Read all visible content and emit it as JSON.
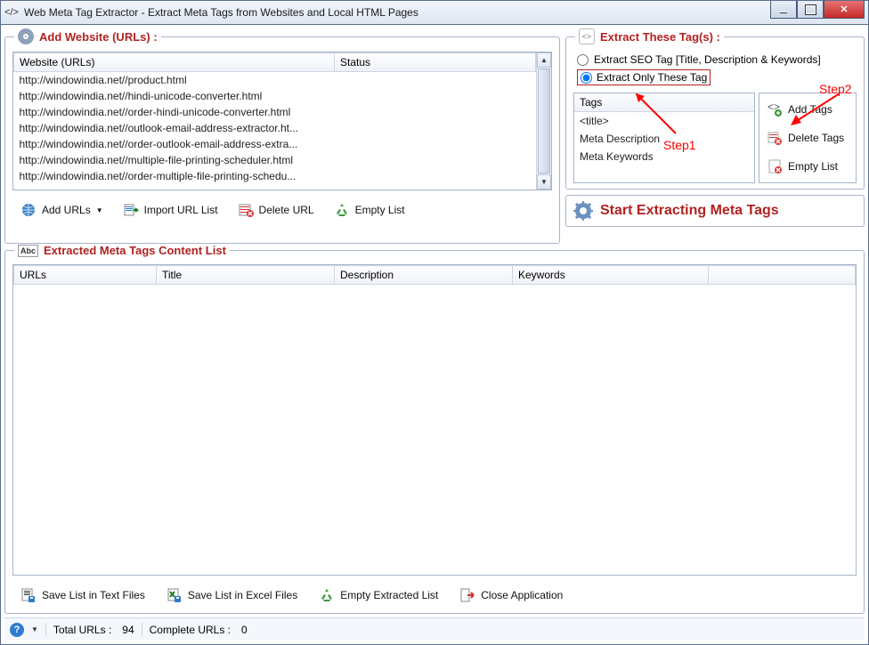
{
  "window": {
    "title": "Web Meta Tag Extractor - Extract Meta Tags from Websites and Local HTML Pages"
  },
  "panels": {
    "add_urls": {
      "heading": "Add Website (URLs) :",
      "columns": {
        "website": "Website (URLs)",
        "status": "Status"
      },
      "rows": [
        "http://windowindia.net//product.html",
        "http://windowindia.net//hindi-unicode-converter.html",
        "http://windowindia.net//order-hindi-unicode-converter.html",
        "http://windowindia.net//outlook-email-address-extractor.ht...",
        "http://windowindia.net//order-outlook-email-address-extra...",
        "http://windowindia.net//multiple-file-printing-scheduler.html",
        "http://windowindia.net//order-multiple-file-printing-schedu..."
      ],
      "buttons": {
        "add": "Add URLs",
        "import": "Import URL List",
        "delete": "Delete URL",
        "empty": "Empty List"
      }
    },
    "extract_tags": {
      "heading": "Extract These Tag(s) :",
      "radio_seo": "Extract SEO Tag [Title, Description & Keywords]",
      "radio_only": "Extract Only These Tag",
      "tags_header": "Tags",
      "tags": [
        "<title>",
        "Meta Description",
        "Meta Keywords"
      ],
      "buttons": {
        "add": "Add Tags",
        "delete": "Delete Tags",
        "empty": "Empty List"
      }
    },
    "start": "Start Extracting Meta Tags",
    "extracted": {
      "heading": "Extracted Meta Tags Content List",
      "columns": {
        "urls": "URLs",
        "title": "Title",
        "description": "Description",
        "keywords": "Keywords"
      }
    }
  },
  "bottom": {
    "save_text": "Save List in Text Files",
    "save_excel": "Save List in Excel Files",
    "empty": "Empty Extracted List",
    "close": "Close Application"
  },
  "status": {
    "total_label": "Total URLs :",
    "total_value": "94",
    "complete_label": "Complete URLs :",
    "complete_value": "0"
  },
  "annotations": {
    "step1": "Step1",
    "step2": "Step2"
  }
}
